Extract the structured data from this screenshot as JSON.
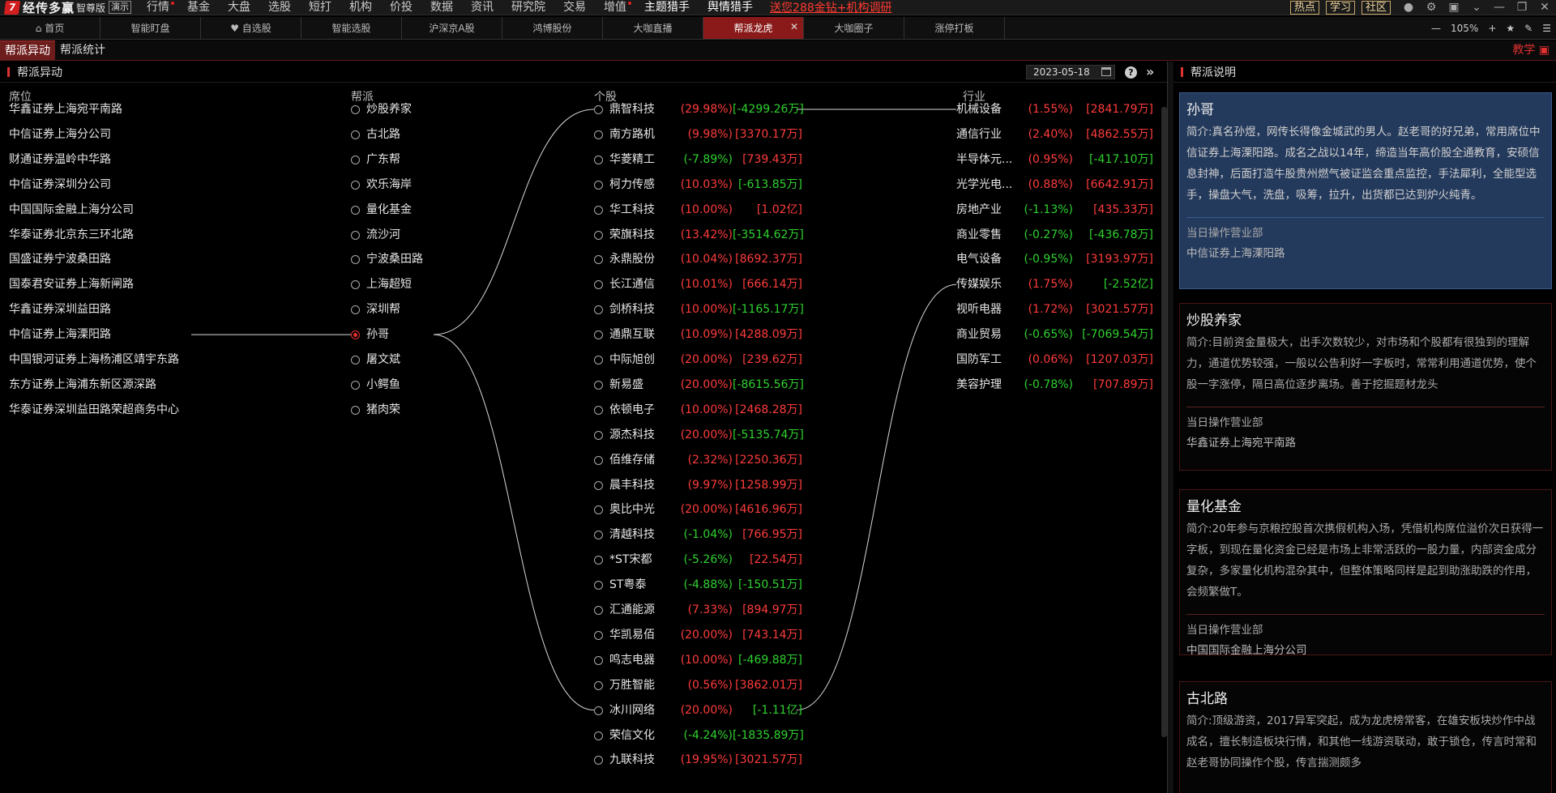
{
  "menubar": {
    "brand": "经传多赢",
    "edition": "智尊版",
    "demo": "演示",
    "items": [
      "行情",
      "基金",
      "大盘",
      "选股",
      "短打",
      "机构",
      "价投",
      "数据",
      "资讯",
      "研究院",
      "交易",
      "增值",
      "主题猎手",
      "舆情猎手"
    ],
    "promo": "送您288金钻+机构调研",
    "pills": [
      "热点",
      "学习",
      "社区"
    ]
  },
  "tabs": [
    "首页",
    "智能盯盘",
    "自选股",
    "智能选股",
    "沪深京A股",
    "鸿博股份",
    "大咖直播",
    "帮派龙虎",
    "大咖圈子",
    "涨停打板"
  ],
  "active_tab": 7,
  "zoom": "105%",
  "subtabs": [
    "帮派异动",
    "帮派统计"
  ],
  "teach": "教学",
  "panel": {
    "title": "帮派异动",
    "date": "2023-05-18",
    "help": "?",
    "fold": "»"
  },
  "columns": {
    "seat": "席位",
    "gang": "帮派",
    "stock": "个股",
    "industry": "行业"
  },
  "seats": [
    "华鑫证券上海宛平南路",
    "中信证券上海分公司",
    "财通证券温岭中华路",
    "中信证券深圳分公司",
    "中国国际金融上海分公司",
    "华泰证券北京东三环北路",
    "国盛证券宁波桑田路",
    "国泰君安证券上海新闸路",
    "华鑫证券深圳益田路",
    "中信证券上海溧阳路",
    "中国银河证券上海杨浦区靖宇东路",
    "东方证券上海浦东新区源深路",
    "华泰证券深圳益田路荣超商务中心"
  ],
  "gangs": [
    "炒股养家",
    "古北路",
    "广东帮",
    "欢乐海岸",
    "量化基金",
    "流沙河",
    "宁波桑田路",
    "上海超短",
    "深圳帮",
    "孙哥",
    "屠文斌",
    "小鳄鱼",
    "猪肉荣"
  ],
  "selected_gang": 9,
  "stocks": [
    {
      "name": "鼎智科技",
      "pct": "(29.98%)",
      "amt": "[-4299.26万]",
      "pc": "up",
      "ac": "dn"
    },
    {
      "name": "南方路机",
      "pct": "(9.98%)",
      "amt": "[3370.17万]",
      "pc": "up",
      "ac": "up"
    },
    {
      "name": "华菱精工",
      "pct": "(-7.89%)",
      "amt": "[739.43万]",
      "pc": "dn",
      "ac": "up"
    },
    {
      "name": "柯力传感",
      "pct": "(10.03%)",
      "amt": "[-613.85万]",
      "pc": "up",
      "ac": "dn"
    },
    {
      "name": "华工科技",
      "pct": "(10.00%)",
      "amt": "[1.02亿]",
      "pc": "up",
      "ac": "up"
    },
    {
      "name": "荣旗科技",
      "pct": "(13.42%)",
      "amt": "[-3514.62万]",
      "pc": "up",
      "ac": "dn"
    },
    {
      "name": "永鼎股份",
      "pct": "(10.04%)",
      "amt": "[8692.37万]",
      "pc": "up",
      "ac": "up"
    },
    {
      "name": "长江通信",
      "pct": "(10.01%)",
      "amt": "[666.14万]",
      "pc": "up",
      "ac": "up"
    },
    {
      "name": "剑桥科技",
      "pct": "(10.00%)",
      "amt": "[-1165.17万]",
      "pc": "up",
      "ac": "dn"
    },
    {
      "name": "通鼎互联",
      "pct": "(10.09%)",
      "amt": "[4288.09万]",
      "pc": "up",
      "ac": "up"
    },
    {
      "name": "中际旭创",
      "pct": "(20.00%)",
      "amt": "[239.62万]",
      "pc": "up",
      "ac": "up"
    },
    {
      "name": "新易盛",
      "pct": "(20.00%)",
      "amt": "[-8615.56万]",
      "pc": "up",
      "ac": "dn"
    },
    {
      "name": "依顿电子",
      "pct": "(10.00%)",
      "amt": "[2468.28万]",
      "pc": "up",
      "ac": "up"
    },
    {
      "name": "源杰科技",
      "pct": "(20.00%)",
      "amt": "[-5135.74万]",
      "pc": "up",
      "ac": "dn"
    },
    {
      "name": "佰维存储",
      "pct": "(2.32%)",
      "amt": "[2250.36万]",
      "pc": "up",
      "ac": "up"
    },
    {
      "name": "晨丰科技",
      "pct": "(9.97%)",
      "amt": "[1258.99万]",
      "pc": "up",
      "ac": "up"
    },
    {
      "name": "奥比中光",
      "pct": "(20.00%)",
      "amt": "[4616.96万]",
      "pc": "up",
      "ac": "up"
    },
    {
      "name": "清越科技",
      "pct": "(-1.04%)",
      "amt": "[766.95万]",
      "pc": "dn",
      "ac": "up"
    },
    {
      "name": "*ST宋都",
      "pct": "(-5.26%)",
      "amt": "[22.54万]",
      "pc": "dn",
      "ac": "up"
    },
    {
      "name": "ST粤泰",
      "pct": "(-4.88%)",
      "amt": "[-150.51万]",
      "pc": "dn",
      "ac": "dn"
    },
    {
      "name": "汇通能源",
      "pct": "(7.33%)",
      "amt": "[894.97万]",
      "pc": "up",
      "ac": "up"
    },
    {
      "name": "华凯易佰",
      "pct": "(20.00%)",
      "amt": "[743.14万]",
      "pc": "up",
      "ac": "up"
    },
    {
      "name": "鸣志电器",
      "pct": "(10.00%)",
      "amt": "[-469.88万]",
      "pc": "up",
      "ac": "dn"
    },
    {
      "name": "万胜智能",
      "pct": "(0.56%)",
      "amt": "[3862.01万]",
      "pc": "up",
      "ac": "up"
    },
    {
      "name": "冰川网络",
      "pct": "(20.00%)",
      "amt": "[-1.11亿]",
      "pc": "up",
      "ac": "dn"
    },
    {
      "name": "荣信文化",
      "pct": "(-4.24%)",
      "amt": "[-1835.89万]",
      "pc": "dn",
      "ac": "dn"
    },
    {
      "name": "九联科技",
      "pct": "(19.95%)",
      "amt": "[3021.57万]",
      "pc": "up",
      "ac": "up"
    }
  ],
  "industries": [
    {
      "name": "机械设备",
      "pct": "(1.55%)",
      "amt": "[2841.79万]",
      "pc": "up",
      "ac": "up"
    },
    {
      "name": "通信行业",
      "pct": "(2.40%)",
      "amt": "[4862.55万]",
      "pc": "up",
      "ac": "up"
    },
    {
      "name": "半导体元...",
      "pct": "(0.95%)",
      "amt": "[-417.10万]",
      "pc": "up",
      "ac": "dn"
    },
    {
      "name": "光学光电...",
      "pct": "(0.88%)",
      "amt": "[6642.91万]",
      "pc": "up",
      "ac": "up"
    },
    {
      "name": "房地产业",
      "pct": "(-1.13%)",
      "amt": "[435.33万]",
      "pc": "dn",
      "ac": "up"
    },
    {
      "name": "商业零售",
      "pct": "(-0.27%)",
      "amt": "[-436.78万]",
      "pc": "dn",
      "ac": "dn"
    },
    {
      "name": "电气设备",
      "pct": "(-0.95%)",
      "amt": "[3193.97万]",
      "pc": "dn",
      "ac": "up"
    },
    {
      "name": "传媒娱乐",
      "pct": "(1.75%)",
      "amt": "[-2.52亿]",
      "pc": "up",
      "ac": "dn"
    },
    {
      "name": "视听电器",
      "pct": "(1.72%)",
      "amt": "[3021.57万]",
      "pc": "up",
      "ac": "up"
    },
    {
      "name": "商业贸易",
      "pct": "(-0.65%)",
      "amt": "[-7069.54万]",
      "pc": "dn",
      "ac": "dn"
    },
    {
      "name": "国防军工",
      "pct": "(0.06%)",
      "amt": "[1207.03万]",
      "pc": "up",
      "ac": "up"
    },
    {
      "name": "美容护理",
      "pct": "(-0.78%)",
      "amt": "[707.89万]",
      "pc": "dn",
      "ac": "up"
    }
  ],
  "links": {
    "seat_to_gang": [
      [
        9,
        9
      ]
    ],
    "gang_to_stock": [
      [
        9,
        0
      ],
      [
        9,
        24
      ]
    ],
    "stock_to_industry": [
      [
        0,
        0
      ],
      [
        24,
        7
      ]
    ]
  },
  "right": {
    "title": "帮派说明",
    "cards": [
      {
        "name": "孙哥",
        "desc": "简介:真名孙煜，网传长得像金城武的男人。赵老哥的好兄弟，常用席位中信证券上海溧阳路。成名之战以14年，缔造当年高价股全通教育，安硕信息封神，后面打造牛股贵州燃气被证监会重点监控，手法犀利，全能型选手，操盘大气，洗盘，吸筹，拉升，出货都已达到炉火纯青。",
        "label": "当日操作营业部",
        "seat": "中信证券上海溧阳路"
      },
      {
        "name": "炒股养家",
        "desc": "简介:目前资金量极大，出手次数较少，对市场和个股都有很独到的理解力，通道优势较强，一般以公告利好一字板时，常常利用通道优势，使个股一字涨停，隔日高位逐步离场。善于挖掘题材龙头",
        "label": "当日操作营业部",
        "seat": "华鑫证券上海宛平南路"
      },
      {
        "name": "量化基金",
        "desc": "简介:20年参与京粮控股首次携假机构入场，凭借机构席位溢价次日获得一字板，到现在量化资金已经是市场上非常活跃的一股力量，内部资金成分复杂，多家量化机构混杂其中，但整体策略同样是起到助涨助跌的作用，会频繁做T。",
        "label": "当日操作营业部",
        "seat": "中国国际金融上海分公司"
      },
      {
        "name": "古北路",
        "desc": "简介:顶级游资，2017异军突起，成为龙虎榜常客，在雄安板块炒作中战成名，擅长制造板块行情，和其他一线游资联动，敢于锁仓，传言时常和赵老哥协同操作个股，传言揣测颇多",
        "label": "",
        "seat": ""
      }
    ]
  }
}
